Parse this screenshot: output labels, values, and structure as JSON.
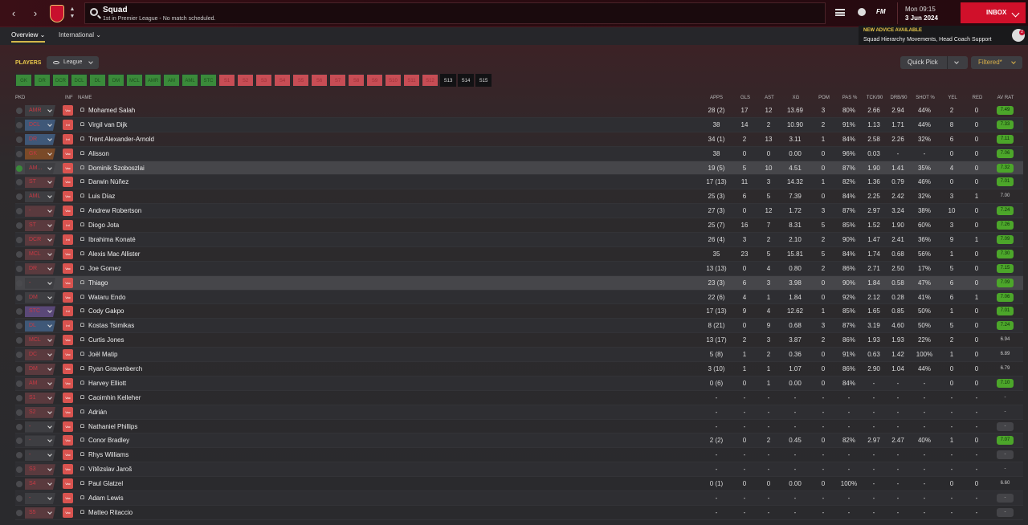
{
  "nav": {
    "back": "‹",
    "forward": "›"
  },
  "search": {
    "title": "Squad",
    "subtitle": "1st in Premier League - No match scheduled."
  },
  "datetime": {
    "day": "Mon 09:15",
    "date": "3 Jun 2024"
  },
  "inbox_label": "INBOX",
  "fm_logo": "FM",
  "tabs": {
    "overview": "Overview",
    "international": "International"
  },
  "advice": {
    "label": "NEW ADVICE AVAILABLE",
    "text": "Squad Hierarchy Movements, Head Coach Support",
    "badge": "2"
  },
  "players_label": "PLAYERS",
  "league_btn": "League",
  "quick_pick": "Quick Pick",
  "filtered": "Filtered*",
  "position_filters": [
    {
      "label": "GK",
      "state": "green"
    },
    {
      "label": "DR",
      "state": "green"
    },
    {
      "label": "DCR",
      "state": "green"
    },
    {
      "label": "DCL",
      "state": "green"
    },
    {
      "label": "DL",
      "state": "green"
    },
    {
      "label": "DM",
      "state": "green"
    },
    {
      "label": "MCL",
      "state": "green"
    },
    {
      "label": "AMR",
      "state": "green"
    },
    {
      "label": "AM",
      "state": "green"
    },
    {
      "label": "AML",
      "state": "green"
    },
    {
      "label": "STC",
      "state": "green"
    },
    {
      "label": "S1",
      "state": "red"
    },
    {
      "label": "S2",
      "state": "red"
    },
    {
      "label": "S3",
      "state": "red"
    },
    {
      "label": "S4",
      "state": "red"
    },
    {
      "label": "S5",
      "state": "red"
    },
    {
      "label": "S6",
      "state": "red"
    },
    {
      "label": "S7",
      "state": "red"
    },
    {
      "label": "S8",
      "state": "red"
    },
    {
      "label": "S9",
      "state": "red"
    },
    {
      "label": "S10",
      "state": "red"
    },
    {
      "label": "S11",
      "state": "red"
    },
    {
      "label": "S12",
      "state": "red"
    },
    {
      "label": "S13",
      "state": "dark"
    },
    {
      "label": "S14",
      "state": "dark"
    },
    {
      "label": "S15",
      "state": "dark"
    }
  ],
  "columns": {
    "pkd": "PKD",
    "inf": "INF",
    "name": "NAME",
    "apps": "APPS",
    "gls": "GLS",
    "ast": "AST",
    "xg": "XG",
    "pom": "POM",
    "pas": "PAS %",
    "tck": "TCK/90",
    "drb": "DRB/90",
    "shot": "SHOT %",
    "yel": "YEL",
    "red": "RED",
    "avrat": "AV RAT"
  },
  "players": [
    {
      "pkd": false,
      "pos": "AMR",
      "posc": "plain",
      "inf": "Vac",
      "name": "Mohamed Salah",
      "apps": "28 (2)",
      "gls": "17",
      "ast": "12",
      "xg": "13.69",
      "pom": "3",
      "pas": "80%",
      "tck": "2.66",
      "drb": "2.94",
      "shot": "44%",
      "yel": "2",
      "red": "0",
      "rat": "7.49",
      "ratc": "green"
    },
    {
      "pkd": false,
      "pos": "DCL",
      "posc": "blue",
      "inf": "Int",
      "name": "Virgil van Dijk",
      "apps": "38",
      "gls": "14",
      "ast": "2",
      "xg": "10.90",
      "pom": "2",
      "pas": "91%",
      "tck": "1.13",
      "drb": "1.71",
      "shot": "44%",
      "yel": "8",
      "red": "0",
      "rat": "7.33",
      "ratc": "green"
    },
    {
      "pkd": false,
      "pos": "DR",
      "posc": "blue",
      "inf": "Int",
      "name": "Trent Alexander-Arnold",
      "apps": "34 (1)",
      "gls": "2",
      "ast": "13",
      "xg": "3.11",
      "pom": "1",
      "pas": "84%",
      "tck": "2.58",
      "drb": "2.26",
      "shot": "32%",
      "yel": "6",
      "red": "0",
      "rat": "7.11",
      "ratc": "green"
    },
    {
      "pkd": false,
      "pos": "GK",
      "posc": "orange",
      "inf": "Vac",
      "name": "Alisson",
      "apps": "38",
      "gls": "0",
      "ast": "0",
      "xg": "0.00",
      "pom": "0",
      "pas": "96%",
      "tck": "0.03",
      "drb": "-",
      "shot": "-",
      "yel": "0",
      "red": "0",
      "rat": "7.06",
      "ratc": "green"
    },
    {
      "pkd": true,
      "pos": "AM...",
      "posc": "plain",
      "inf": "Vac",
      "name": "Dominik Szoboszlai",
      "apps": "19 (5)",
      "gls": "5",
      "ast": "10",
      "xg": "4.51",
      "pom": "0",
      "pas": "87%",
      "tck": "1.90",
      "drb": "1.41",
      "shot": "35%",
      "yel": "4",
      "red": "0",
      "rat": "7.32",
      "ratc": "green",
      "sel": true
    },
    {
      "pkd": false,
      "pos": "ST",
      "posc": "red",
      "inf": "Vac",
      "name": "Darwin Núñez",
      "apps": "17 (13)",
      "gls": "11",
      "ast": "3",
      "xg": "14.32",
      "pom": "1",
      "pas": "82%",
      "tck": "1.36",
      "drb": "0.79",
      "shot": "46%",
      "yel": "0",
      "red": "0",
      "rat": "7.01",
      "ratc": "green"
    },
    {
      "pkd": false,
      "pos": "AML",
      "posc": "plain",
      "inf": "Vac",
      "name": "Luis Díaz",
      "apps": "25 (3)",
      "gls": "6",
      "ast": "5",
      "xg": "7.39",
      "pom": "0",
      "pas": "84%",
      "tck": "2.25",
      "drb": "2.42",
      "shot": "32%",
      "yel": "3",
      "red": "1",
      "rat": "7.00",
      "ratc": "plain"
    },
    {
      "pkd": false,
      "pos": "-",
      "posc": "red",
      "inf": "Vac",
      "name": "Andrew Robertson",
      "apps": "27 (3)",
      "gls": "0",
      "ast": "12",
      "xg": "1.72",
      "pom": "3",
      "pas": "87%",
      "tck": "2.97",
      "drb": "3.24",
      "shot": "38%",
      "yel": "10",
      "red": "0",
      "rat": "7.24",
      "ratc": "green"
    },
    {
      "pkd": false,
      "pos": "ST",
      "posc": "red",
      "inf": "Int",
      "name": "Diogo Jota",
      "apps": "25 (7)",
      "gls": "16",
      "ast": "7",
      "xg": "8.31",
      "pom": "5",
      "pas": "85%",
      "tck": "1.52",
      "drb": "1.90",
      "shot": "60%",
      "yel": "3",
      "red": "0",
      "rat": "7.26",
      "ratc": "green"
    },
    {
      "pkd": false,
      "pos": "DCR",
      "posc": "red",
      "inf": "Int",
      "name": "Ibrahima Konaté",
      "apps": "26 (4)",
      "gls": "3",
      "ast": "2",
      "xg": "2.10",
      "pom": "2",
      "pas": "90%",
      "tck": "1.47",
      "drb": "2.41",
      "shot": "36%",
      "yel": "9",
      "red": "1",
      "rat": "7.09",
      "ratc": "green"
    },
    {
      "pkd": false,
      "pos": "MCL",
      "posc": "red",
      "inf": "Vac",
      "name": "Alexis Mac Allister",
      "apps": "35",
      "gls": "23",
      "ast": "5",
      "xg": "15.81",
      "pom": "5",
      "pas": "84%",
      "tck": "1.74",
      "drb": "0.68",
      "shot": "56%",
      "yel": "1",
      "red": "0",
      "rat": "7.30",
      "ratc": "green"
    },
    {
      "pkd": false,
      "pos": "DR",
      "posc": "red",
      "inf": "Vac",
      "name": "Joe Gomez",
      "apps": "13 (13)",
      "gls": "0",
      "ast": "4",
      "xg": "0.80",
      "pom": "2",
      "pas": "86%",
      "tck": "2.71",
      "drb": "2.50",
      "shot": "17%",
      "yel": "5",
      "red": "0",
      "rat": "7.15",
      "ratc": "green"
    },
    {
      "pkd": false,
      "pos": "-",
      "posc": "plain",
      "inf": "Vac",
      "name": "Thiago",
      "apps": "23 (3)",
      "gls": "6",
      "ast": "3",
      "xg": "3.98",
      "pom": "0",
      "pas": "90%",
      "tck": "1.84",
      "drb": "0.58",
      "shot": "47%",
      "yel": "6",
      "red": "0",
      "rat": "7.09",
      "ratc": "green",
      "sel": true
    },
    {
      "pkd": false,
      "pos": "DM",
      "posc": "plain",
      "inf": "Vac",
      "name": "Wataru Endo",
      "apps": "22 (6)",
      "gls": "4",
      "ast": "1",
      "xg": "1.84",
      "pom": "0",
      "pas": "92%",
      "tck": "2.12",
      "drb": "0.28",
      "shot": "41%",
      "yel": "6",
      "red": "1",
      "rat": "7.06",
      "ratc": "green"
    },
    {
      "pkd": false,
      "pos": "STC",
      "posc": "purple",
      "inf": "Int",
      "name": "Cody Gakpo",
      "apps": "17 (13)",
      "gls": "9",
      "ast": "4",
      "xg": "12.62",
      "pom": "1",
      "pas": "85%",
      "tck": "1.65",
      "drb": "0.85",
      "shot": "50%",
      "yel": "1",
      "red": "0",
      "rat": "7.01",
      "ratc": "green"
    },
    {
      "pkd": false,
      "pos": "DL",
      "posc": "blue",
      "inf": "Int",
      "name": "Kostas Tsimikas",
      "apps": "8 (21)",
      "gls": "0",
      "ast": "9",
      "xg": "0.68",
      "pom": "3",
      "pas": "87%",
      "tck": "3.19",
      "drb": "4.60",
      "shot": "50%",
      "yel": "5",
      "red": "0",
      "rat": "7.24",
      "ratc": "green"
    },
    {
      "pkd": false,
      "pos": "MCL",
      "posc": "red",
      "inf": "Vac",
      "name": "Curtis Jones",
      "apps": "13 (17)",
      "gls": "2",
      "ast": "3",
      "xg": "3.87",
      "pom": "2",
      "pas": "86%",
      "tck": "1.93",
      "drb": "1.93",
      "shot": "22%",
      "yel": "2",
      "red": "0",
      "rat": "6.94",
      "ratc": "plain"
    },
    {
      "pkd": false,
      "pos": "DC",
      "posc": "red",
      "inf": "Vac",
      "name": "Joël Matip",
      "apps": "5 (8)",
      "gls": "1",
      "ast": "2",
      "xg": "0.36",
      "pom": "0",
      "pas": "91%",
      "tck": "0.63",
      "drb": "1.42",
      "shot": "100%",
      "yel": "1",
      "red": "0",
      "rat": "6.89",
      "ratc": "plain"
    },
    {
      "pkd": false,
      "pos": "DM",
      "posc": "red",
      "inf": "Vac",
      "name": "Ryan Gravenberch",
      "apps": "3 (10)",
      "gls": "1",
      "ast": "1",
      "xg": "1.07",
      "pom": "0",
      "pas": "86%",
      "tck": "2.90",
      "drb": "1.04",
      "shot": "44%",
      "yel": "0",
      "red": "0",
      "rat": "6.79",
      "ratc": "plain"
    },
    {
      "pkd": false,
      "pos": "AM",
      "posc": "red",
      "inf": "Vac",
      "name": "Harvey Elliott",
      "apps": "0 (6)",
      "gls": "0",
      "ast": "1",
      "xg": "0.00",
      "pom": "0",
      "pas": "84%",
      "tck": "-",
      "drb": "-",
      "shot": "-",
      "yel": "0",
      "red": "0",
      "rat": "7.10",
      "ratc": "green"
    },
    {
      "pkd": false,
      "pos": "S1",
      "posc": "red",
      "inf": "Vac",
      "name": "Caoimhin Kelleher",
      "apps": "-",
      "gls": "-",
      "ast": "-",
      "xg": "-",
      "pom": "-",
      "pas": "-",
      "tck": "-",
      "drb": "-",
      "shot": "-",
      "yel": "-",
      "red": "-",
      "rat": "-",
      "ratc": "plain"
    },
    {
      "pkd": false,
      "pos": "S2",
      "posc": "red",
      "inf": "Vac",
      "name": "Adrián",
      "apps": "-",
      "gls": "-",
      "ast": "-",
      "xg": "-",
      "pom": "-",
      "pas": "-",
      "tck": "-",
      "drb": "-",
      "shot": "-",
      "yel": "-",
      "red": "-",
      "rat": "-",
      "ratc": "plain"
    },
    {
      "pkd": false,
      "pos": "-",
      "posc": "plain",
      "inf": "Vac",
      "name": "Nathaniel Phillips",
      "apps": "-",
      "gls": "-",
      "ast": "-",
      "xg": "-",
      "pom": "-",
      "pas": "-",
      "tck": "-",
      "drb": "-",
      "shot": "-",
      "yel": "-",
      "red": "-",
      "rat": "-",
      "ratc": "dark"
    },
    {
      "pkd": false,
      "pos": "-",
      "posc": "plain",
      "inf": "Vac",
      "name": "Conor Bradley",
      "apps": "2 (2)",
      "gls": "0",
      "ast": "2",
      "xg": "0.45",
      "pom": "0",
      "pas": "82%",
      "tck": "2.97",
      "drb": "2.47",
      "shot": "40%",
      "yel": "1",
      "red": "0",
      "rat": "7.07",
      "ratc": "green"
    },
    {
      "pkd": false,
      "pos": "-",
      "posc": "plain",
      "inf": "Vac",
      "name": "Rhys Williams",
      "apps": "-",
      "gls": "-",
      "ast": "-",
      "xg": "-",
      "pom": "-",
      "pas": "-",
      "tck": "-",
      "drb": "-",
      "shot": "-",
      "yel": "-",
      "red": "-",
      "rat": "-",
      "ratc": "dark"
    },
    {
      "pkd": false,
      "pos": "S3",
      "posc": "red",
      "inf": "Vac",
      "name": "Vítězslav Jaroš",
      "apps": "-",
      "gls": "-",
      "ast": "-",
      "xg": "-",
      "pom": "-",
      "pas": "-",
      "tck": "-",
      "drb": "-",
      "shot": "-",
      "yel": "-",
      "red": "-",
      "rat": "-",
      "ratc": "plain"
    },
    {
      "pkd": false,
      "pos": "S4",
      "posc": "red",
      "inf": "Vac",
      "name": "Paul Glatzel",
      "apps": "0 (1)",
      "gls": "0",
      "ast": "0",
      "xg": "0.00",
      "pom": "0",
      "pas": "100%",
      "tck": "-",
      "drb": "-",
      "shot": "-",
      "yel": "0",
      "red": "0",
      "rat": "6.60",
      "ratc": "plain"
    },
    {
      "pkd": false,
      "pos": "-",
      "posc": "plain",
      "inf": "Vac",
      "name": "Adam Lewis",
      "apps": "-",
      "gls": "-",
      "ast": "-",
      "xg": "-",
      "pom": "-",
      "pas": "-",
      "tck": "-",
      "drb": "-",
      "shot": "-",
      "yel": "-",
      "red": "-",
      "rat": "-",
      "ratc": "dark"
    },
    {
      "pkd": false,
      "pos": "S5",
      "posc": "red",
      "inf": "Vac",
      "name": "Matteo Ritaccio",
      "apps": "-",
      "gls": "-",
      "ast": "-",
      "xg": "-",
      "pom": "-",
      "pas": "-",
      "tck": "-",
      "drb": "-",
      "shot": "-",
      "yel": "-",
      "red": "-",
      "rat": "-",
      "ratc": "dark"
    }
  ]
}
